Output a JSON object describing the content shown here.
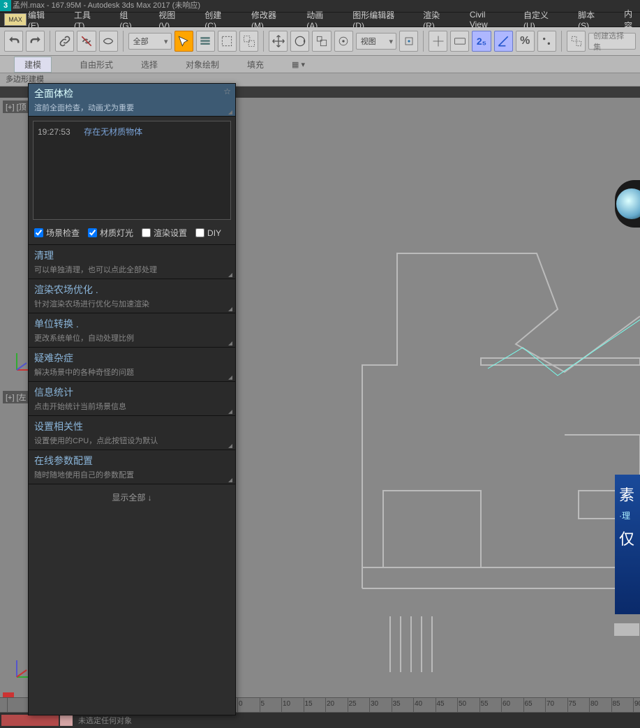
{
  "title": "孟州.max - 167.95M - Autodesk 3ds Max 2017  (未响应)",
  "mode_btn": "MAX",
  "menu": [
    "编辑(E)",
    "工具(T)",
    "组(G)",
    "视图(V)",
    "创建(C)",
    "修改器(M)",
    "动画(A)",
    "图形编辑器(D)",
    "渲染(R)",
    "Civil View",
    "自定义(U)",
    "脚本(S)",
    "内容"
  ],
  "toolbar": {
    "combo1": "全部",
    "combo2": "视图",
    "big2": "2₅",
    "input": "创建选择集"
  },
  "ribbon": {
    "tabs": [
      "建模",
      "自由形式",
      "选择",
      "对象绘制",
      "填充"
    ],
    "drop": "▦ ▾"
  },
  "ribbon2": "多边形建模",
  "vp": {
    "tl": "[+] [顶",
    "bl": "[+] [左"
  },
  "panel": {
    "header": {
      "title": "全面体检",
      "sub": "渲前全面检查，动画尤为重要"
    },
    "log": {
      "time": "19:27:53",
      "msg": "存在无材质物体"
    },
    "checks": [
      {
        "label": "场景检查",
        "checked": true
      },
      {
        "label": "材质灯光",
        "checked": true
      },
      {
        "label": "渲染设置",
        "checked": false
      },
      {
        "label": "DIY",
        "checked": false
      }
    ],
    "sections": [
      {
        "title": "清理",
        "sub": "可以单独清理，也可以点此全部处理"
      },
      {
        "title": "渲染农场优化  .",
        "sub": "针对渲染农场进行优化与加速渲染"
      },
      {
        "title": "单位转换  .",
        "sub": "更改系统单位，自动处理比例"
      },
      {
        "title": "疑难杂症",
        "sub": "解决场景中的各种奇怪的问题"
      },
      {
        "title": "信息统计",
        "sub": "点击开始统计当前场景信息"
      },
      {
        "title": "设置相关性",
        "sub": "设置使用的CPU，点此按钮设为默认"
      },
      {
        "title": "在线参数配置",
        "sub": "随时随地使用自己的参数配置"
      }
    ],
    "showall": "显示全部  ↓"
  },
  "ruler": [
    0,
    5,
    10,
    15,
    20,
    25,
    30,
    35,
    40,
    45,
    50,
    55,
    60,
    65,
    70,
    75,
    80,
    85,
    90
  ],
  "status": "未选定任何对象",
  "promo": {
    "l1": "素",
    "l2": "·理",
    "l3": "仅"
  }
}
